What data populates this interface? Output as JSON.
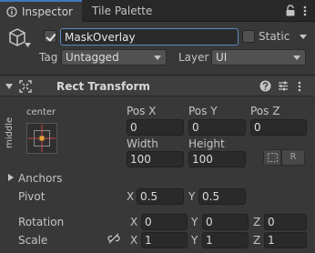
{
  "tabs": [
    {
      "label": "Inspector",
      "active": true
    },
    {
      "label": "Tile Palette",
      "active": false
    }
  ],
  "object": {
    "active": true,
    "name": "MaskOverlay",
    "static_label": "Static",
    "static": false,
    "tag_label": "Tag",
    "tag_value": "Untagged",
    "layer_label": "Layer",
    "layer_value": "UI"
  },
  "component": {
    "title": "Rect Transform",
    "anchor_preset_h": "center",
    "anchor_preset_v": "middle",
    "pos_x_label": "Pos X",
    "pos_y_label": "Pos Y",
    "pos_z_label": "Pos Z",
    "pos_x": "0",
    "pos_y": "0",
    "pos_z": "0",
    "width_label": "Width",
    "height_label": "Height",
    "width": "100",
    "height": "100",
    "raw_button": "R",
    "anchors_label": "Anchors",
    "pivot_label": "Pivot",
    "pivot_x": "0.5",
    "pivot_y": "0.5",
    "rotation_label": "Rotation",
    "rotation_x": "0",
    "rotation_y": "0",
    "rotation_z": "0",
    "scale_label": "Scale",
    "scale_x": "1",
    "scale_y": "1",
    "scale_z": "1",
    "axis_x": "X",
    "axis_y": "Y",
    "axis_z": "Z"
  },
  "colors": {
    "panel": "#383838",
    "tabbar": "#282828",
    "accent": "#3a79bb",
    "field": "#2a2a2a"
  }
}
